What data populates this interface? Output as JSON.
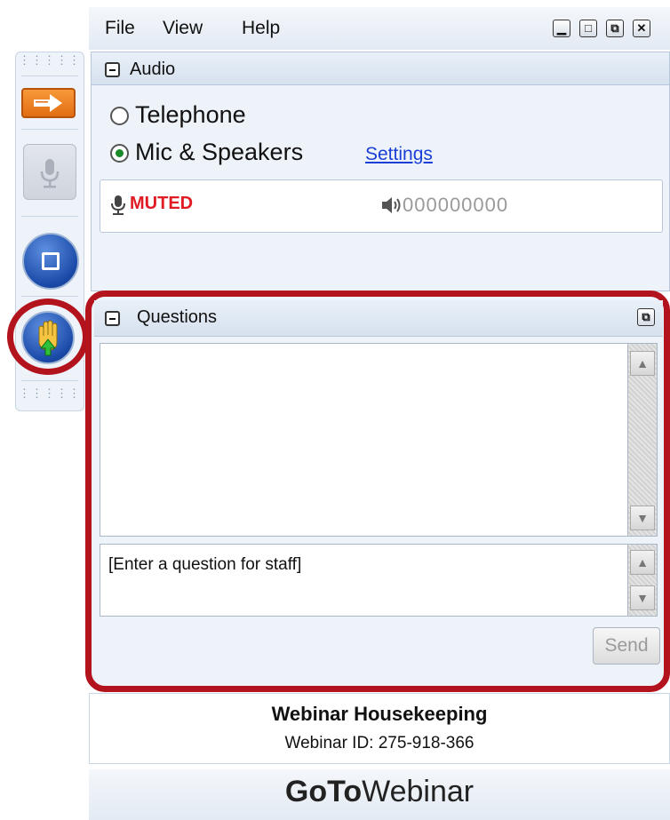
{
  "menu": {
    "file": "File",
    "view": "View",
    "help": "Help"
  },
  "window_controls": {
    "minimize": "▁",
    "maximize": "□",
    "restore": "⧉",
    "close": "✕"
  },
  "audio": {
    "title": "Audio",
    "options": [
      {
        "label": "Telephone",
        "selected": false
      },
      {
        "label": "Mic & Speakers",
        "selected": true
      }
    ],
    "settings_link": "Settings",
    "mic_status": "MUTED",
    "speaker_level": "000000000"
  },
  "questions": {
    "title": "Questions",
    "input_placeholder": "[Enter a question for staff]",
    "send_label": "Send"
  },
  "webinar": {
    "title": "Webinar Housekeeping",
    "id_line": "Webinar ID: 275-918-366"
  },
  "brand": {
    "bold": "GoTo",
    "light": "Webinar"
  },
  "colors": {
    "highlight_red": "#b3131c",
    "muted_red": "#e01b24",
    "link_blue": "#1a3fd6",
    "selected_green": "#1a8a2a"
  },
  "icons": {
    "grip": "drag-grip-icon",
    "arrow": "arrow-right-icon",
    "mic": "microphone-icon",
    "screen": "screen-share-icon",
    "hand": "raise-hand-icon",
    "speaker": "speaker-icon",
    "popout": "popout-icon"
  }
}
